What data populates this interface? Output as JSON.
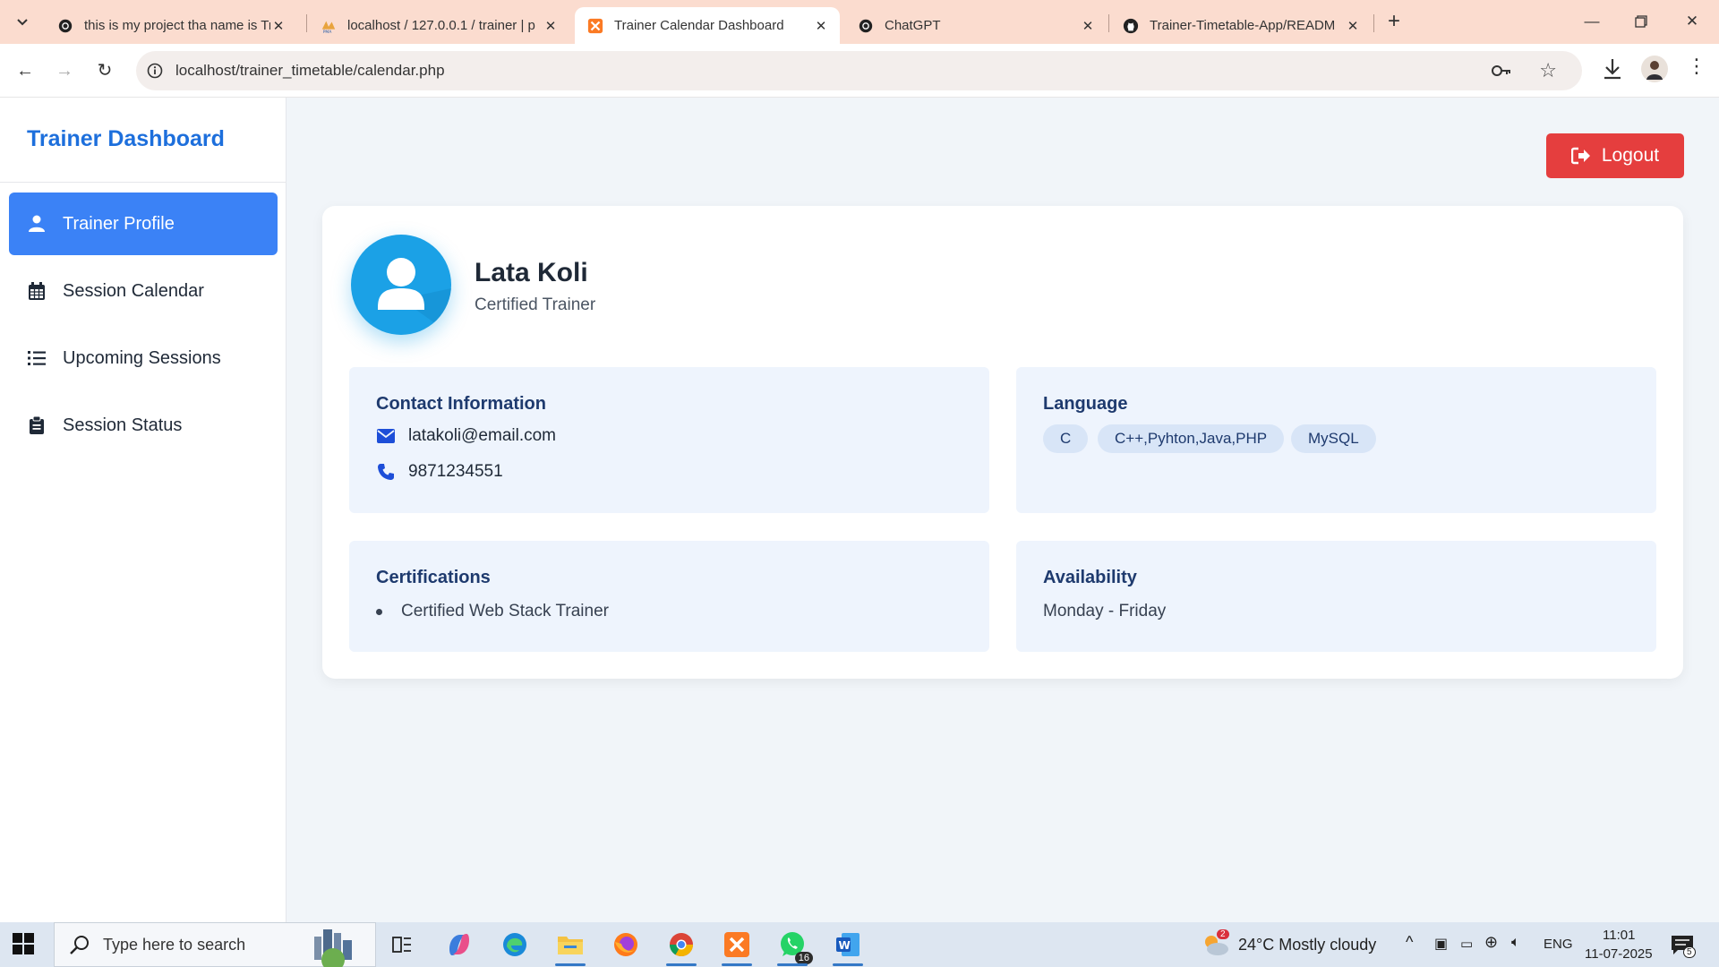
{
  "browser": {
    "tabs": [
      {
        "title": "this is my project tha name is Tr",
        "favicon": "chatgpt-icon"
      },
      {
        "title": "localhost / 127.0.0.1 / trainer | p",
        "favicon": "phpmyadmin-icon"
      },
      {
        "title": "Trainer Calendar Dashboard",
        "favicon": "xampp-icon",
        "active": true
      },
      {
        "title": "ChatGPT",
        "favicon": "chatgpt-icon"
      },
      {
        "title": "Trainer-Timetable-App/READM",
        "favicon": "github-icon"
      }
    ],
    "url": "localhost/trainer_timetable/calendar.php"
  },
  "sidebar": {
    "brand": "Trainer Dashboard",
    "items": [
      {
        "label": "Trainer Profile",
        "icon": "user-icon",
        "active": true
      },
      {
        "label": "Session Calendar",
        "icon": "calendar-icon"
      },
      {
        "label": "Upcoming Sessions",
        "icon": "list-icon"
      },
      {
        "label": "Session Status",
        "icon": "clipboard-icon"
      }
    ]
  },
  "header": {
    "logout_label": "Logout"
  },
  "profile": {
    "name": "Lata Koli",
    "role": "Certified Trainer",
    "contact": {
      "title": "Contact Information",
      "email": "latakoli@email.com",
      "phone": "9871234551"
    },
    "language": {
      "title": "Language",
      "chips": [
        "C",
        "C++,Pyhton,Java,PHP",
        "MySQL"
      ]
    },
    "certifications": {
      "title": "Certifications",
      "items": [
        "Certified Web Stack Trainer"
      ]
    },
    "availability": {
      "title": "Availability",
      "value": "Monday - Friday"
    }
  },
  "colors": {
    "brand": "#1d6fdc",
    "active_nav": "#3b82f6",
    "logout": "#e53e3e",
    "panel_bg": "#eef4fd",
    "avatar": "#1ba1e6"
  },
  "taskbar": {
    "search_placeholder": "Type here to search",
    "weather": "24°C  Mostly cloudy",
    "weather_badge": "2",
    "whatsapp_badge": "16",
    "language": "ENG",
    "time": "11:01",
    "date": "11-07-2025",
    "notifications": "5"
  }
}
